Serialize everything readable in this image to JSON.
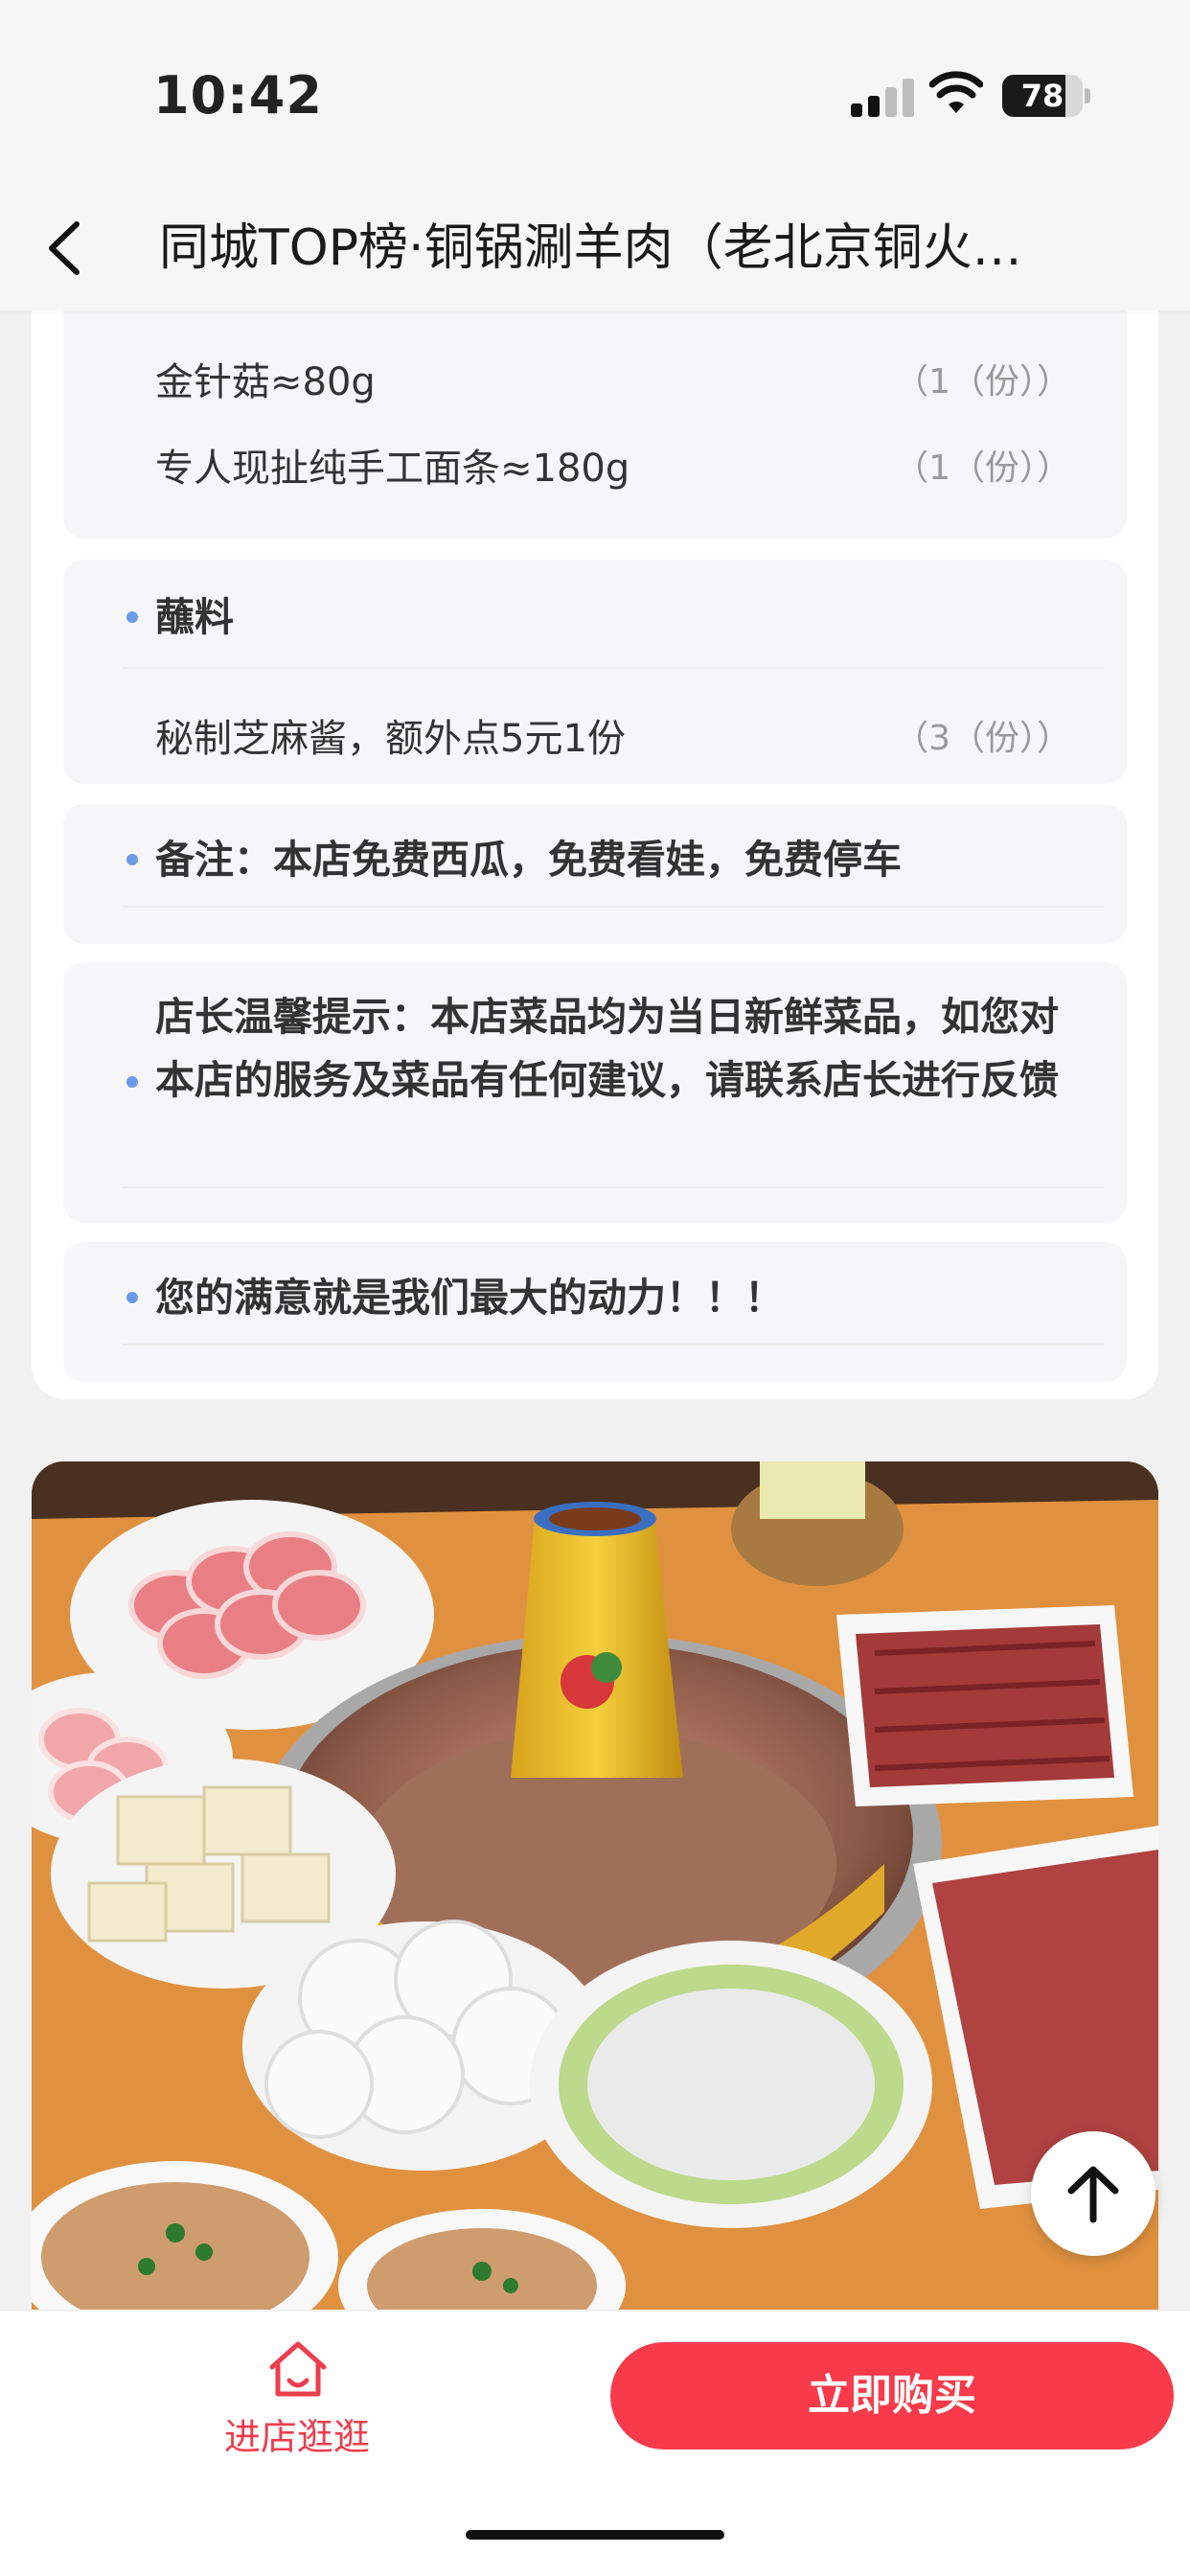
{
  "status_bar": {
    "time": "10:42",
    "battery": "78",
    "battery_level": 0.78
  },
  "nav": {
    "title": "同城TOP榜·铜锅涮羊肉（老北京铜火锅）"
  },
  "menu": {
    "items": [
      {
        "name": "金针菇≈80g",
        "qty": "（1（份））"
      },
      {
        "name": "专人现扯纯手工面条≈180g",
        "qty": "（1（份））"
      }
    ],
    "dip_section": {
      "title": "蘸料",
      "items": [
        {
          "name": "秘制芝麻酱，额外点5元1份",
          "qty": "（3（份））"
        }
      ]
    },
    "notes": [
      "备注：本店免费西瓜，免费看娃，免费停车",
      "店长温馨提示：本店菜品均为当日新鲜菜品，如您对本店的服务及菜品有任何建议，请联系店长进行反馈",
      "您的满意就是我们最大的动力！！！"
    ]
  },
  "bottom_bar": {
    "store_label": "进店逛逛",
    "buy_label": "立即购买",
    "accent": "#f83a4a"
  },
  "icons": [
    "chevron-left-icon",
    "signal-icon",
    "wifi-icon",
    "battery-icon",
    "arrow-up-icon",
    "store-icon"
  ]
}
